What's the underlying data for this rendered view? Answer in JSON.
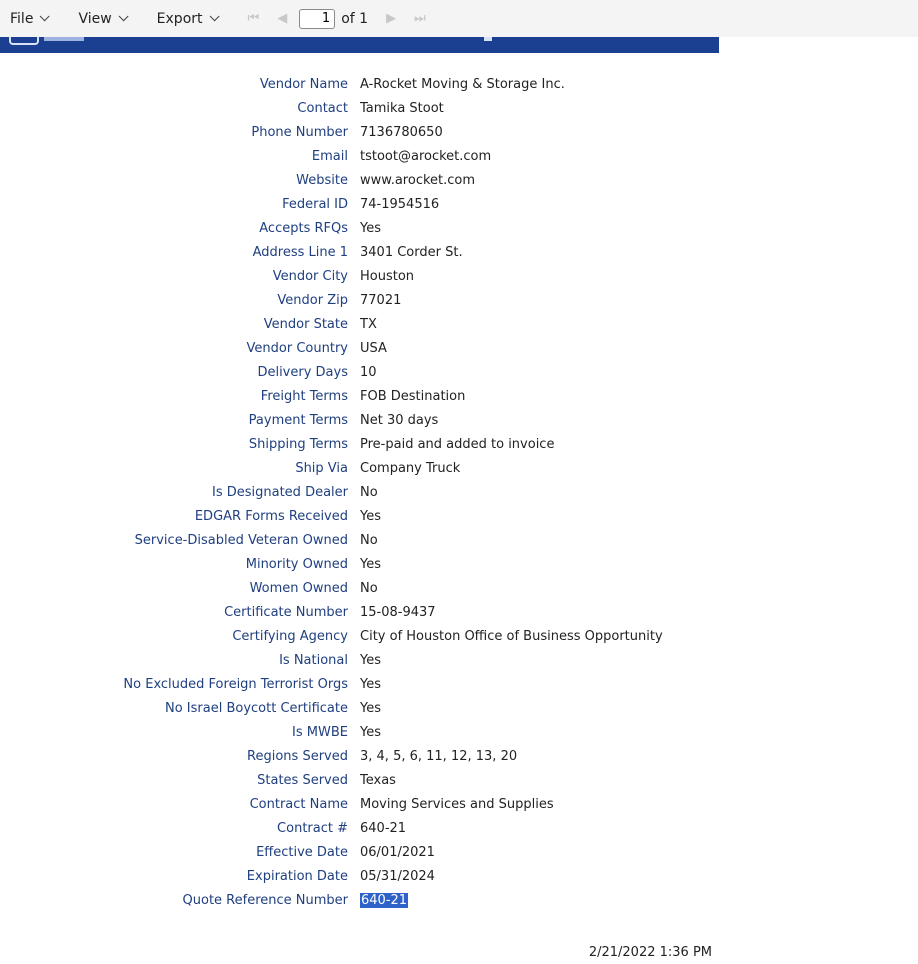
{
  "toolbar": {
    "file_label": "File",
    "view_label": "View",
    "export_label": "Export",
    "first_page": "⏮",
    "prev_page": "◀",
    "current_page": "1",
    "of_pages": "of 1",
    "next_page": "▶",
    "last_page": "⏭"
  },
  "fields": [
    {
      "label": "Vendor Name",
      "value": "A-Rocket Moving & Storage Inc."
    },
    {
      "label": "Contact",
      "value": "Tamika Stoot"
    },
    {
      "label": "Phone Number",
      "value": "7136780650"
    },
    {
      "label": "Email",
      "value": "tstoot@arocket.com"
    },
    {
      "label": "Website",
      "value": "www.arocket.com"
    },
    {
      "label": "Federal ID",
      "value": "74-1954516"
    },
    {
      "label": "Accepts RFQs",
      "value": "Yes"
    },
    {
      "label": "Address Line 1",
      "value": "3401 Corder St."
    },
    {
      "label": "Vendor City",
      "value": "Houston"
    },
    {
      "label": "Vendor Zip",
      "value": "77021"
    },
    {
      "label": "Vendor State",
      "value": "TX"
    },
    {
      "label": "Vendor Country",
      "value": "USA"
    },
    {
      "label": "Delivery Days",
      "value": "10"
    },
    {
      "label": "Freight Terms",
      "value": "FOB Destination"
    },
    {
      "label": "Payment Terms",
      "value": "Net 30 days"
    },
    {
      "label": "Shipping Terms",
      "value": "Pre-paid and added to invoice"
    },
    {
      "label": "Ship Via",
      "value": "Company Truck"
    },
    {
      "label": "Is Designated Dealer",
      "value": "No"
    },
    {
      "label": "EDGAR Forms Received",
      "value": "Yes"
    },
    {
      "label": "Service-Disabled Veteran Owned",
      "value": "No"
    },
    {
      "label": "Minority Owned",
      "value": "Yes"
    },
    {
      "label": "Women Owned",
      "value": "No"
    },
    {
      "label": "Certificate Number",
      "value": "15-08-9437"
    },
    {
      "label": "Certifying Agency",
      "value": "City of Houston Office of Business Opportunity"
    },
    {
      "label": "Is National",
      "value": "Yes"
    },
    {
      "label": "No Excluded Foreign Terrorist Orgs",
      "value": "Yes"
    },
    {
      "label": "No Israel Boycott Certificate",
      "value": "Yes"
    },
    {
      "label": "Is MWBE",
      "value": "Yes"
    },
    {
      "label": "Regions Served",
      "value": "3, 4, 5, 6, 11, 12, 13, 20"
    },
    {
      "label": "States Served",
      "value": "Texas"
    },
    {
      "label": "Contract Name",
      "value": "Moving Services and Supplies"
    },
    {
      "label": "Contract #",
      "value": "640-21"
    },
    {
      "label": "Effective Date",
      "value": "06/01/2021"
    },
    {
      "label": "Expiration Date",
      "value": "05/31/2024"
    },
    {
      "label": "Quote Reference Number",
      "value": "640-21",
      "selected": true
    }
  ],
  "footer": {
    "timestamp": "2/21/2022 1:36 PM"
  },
  "colors": {
    "banner": "#1b3f91",
    "label": "#1f3f80",
    "selection": "#2e62c9"
  }
}
